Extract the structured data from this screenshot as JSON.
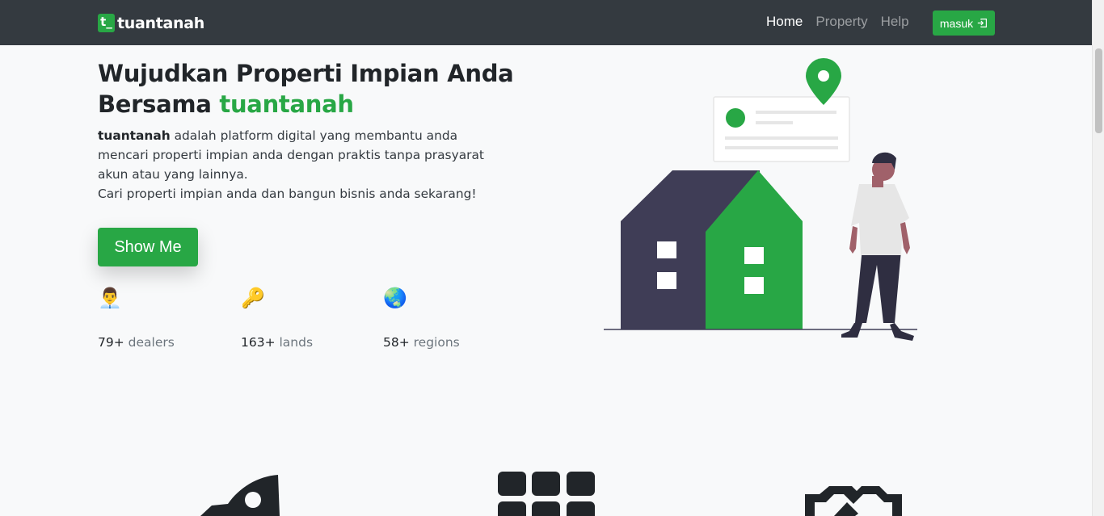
{
  "brand": {
    "box": "t_",
    "name": "tuantanah"
  },
  "nav": {
    "links": [
      {
        "label": "Home",
        "active": true
      },
      {
        "label": "Property",
        "active": false
      },
      {
        "label": "Help",
        "active": false
      }
    ],
    "login_label": "masuk"
  },
  "hero": {
    "title_line1": "Wujudkan Properti Impian Anda",
    "title_line2_prefix": "Bersama ",
    "title_line2_brand": "tuantanah",
    "desc_bold": "tuantanah",
    "desc_line1": " adalah platform digital yang membantu anda mencari properti impian anda dengan praktis tanpa prasyarat akun atau yang lainnya.",
    "desc_line2": "Cari properti impian anda dan bangun bisnis anda sekarang!",
    "cta_label": "Show Me"
  },
  "stats": [
    {
      "icon": "👨‍💼",
      "icon_name": "dealer-icon",
      "value": "79+",
      "label": " dealers"
    },
    {
      "icon": "🔑",
      "icon_name": "key-icon",
      "value": "163+",
      "label": " lands"
    },
    {
      "icon": "🌏",
      "icon_name": "globe-icon",
      "value": "58+",
      "label": " regions"
    }
  ],
  "features": [
    {
      "icon_name": "rocket-icon"
    },
    {
      "icon_name": "grid-icon"
    },
    {
      "icon_name": "handshake-icon"
    }
  ],
  "colors": {
    "accent": "#28a745",
    "navbar": "#343a40",
    "background": "#f8f9fa",
    "house_dark": "#3f3d56"
  }
}
